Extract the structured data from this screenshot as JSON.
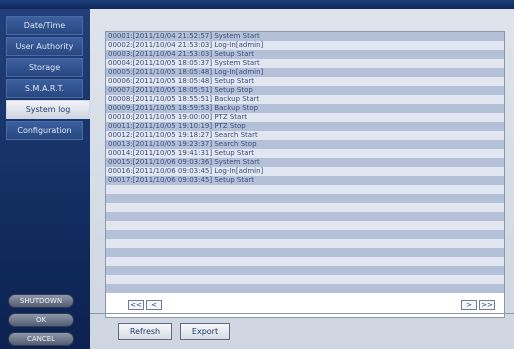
{
  "sidebar": {
    "items": [
      {
        "label": "Date/Time"
      },
      {
        "label": "User Authority"
      },
      {
        "label": "Storage"
      },
      {
        "label": "S.M.A.R.T."
      },
      {
        "label": "System log",
        "active": true
      },
      {
        "label": "Configuration"
      }
    ],
    "buttons": {
      "shutdown": "SHUTDOWN",
      "ok": "OK",
      "cancel": "CANCEL"
    }
  },
  "log": {
    "entries": [
      "00001:[2011/10/04 21:52:57] System Start",
      "00002:[2011/10/04 21:53:03] Log-In[admin]",
      "00003:[2011/10/04 21:53:03] Setup Start",
      "00004:[2011/10/05 18:05:37] System Start",
      "00005:[2011/10/05 18:05:48] Log-In[admin]",
      "00006:[2011/10/05 18:05:48] Setup Start",
      "00007:[2011/10/05 18:05:51] Setup Stop",
      "00008:[2011/10/05 18:55:51] Backup Start",
      "00009:[2011/10/05 18:59:53] Backup Stop",
      "00010:[2011/10/05 19:00:00] PTZ Start",
      "00011:[2011/10/05 19:10:19] PTZ Stop",
      "00012:[2011/10/05 19:18:27] Search Start",
      "00013:[2011/10/05 19:23:37] Search Stop",
      "00014:[2011/10/05 19:41:31] Setup Start",
      "00015:[2011/10/06 09:03:36] System Start",
      "00016:[2011/10/06 09:03:45] Log-In[admin]",
      "00017:[2011/10/06 09:03:45] Setup Start",
      "",
      "",
      "",
      "",
      "",
      "",
      "",
      "",
      "",
      "",
      "",
      ""
    ],
    "pager": {
      "first": "<<",
      "prev": "<",
      "next": ">",
      "last": ">>"
    }
  },
  "actions": {
    "refresh": "Refresh",
    "export": "Export"
  }
}
